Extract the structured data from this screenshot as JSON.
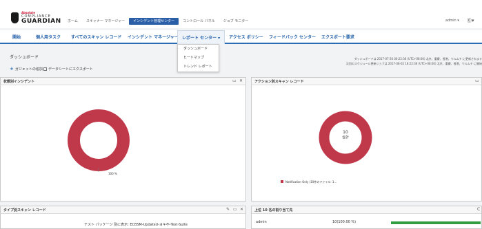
{
  "header": {
    "logo": {
      "brand": "Absolute",
      "line1": "COMPLIANCE",
      "line2": "GUARDIAN"
    },
    "top_nav": [
      "ホーム",
      "スキャナー マネージャー",
      "インシデント管理センター",
      "コントロール パネル",
      "ジョブ モニター"
    ],
    "top_nav_active_index": 2,
    "user": "admin ▾",
    "help": "⓪▾"
  },
  "main_nav": {
    "tabs": [
      "開始",
      "個人用タスク",
      "すべてのスキャン レコード",
      "インシデント マネージャー",
      "レポート センター ▾",
      "アクセス ポリシー",
      "フィードバック センター",
      "エクスポート要求"
    ],
    "active_index": 4
  },
  "dropdown": {
    "items": [
      "ダッシュボード",
      "ヒートマップ",
      "トレンド レポート"
    ]
  },
  "dashboard": {
    "title": "ダッシュボード",
    "add_gadget": "ガジェットの追加",
    "export_to_pdf": "データシートにエクスポート",
    "refresh_line1": "ダッシュボードは 2017-07-20 00:22:36 (UTC+08:00) 北京、重慶、香港、ウルムチ に更新されます",
    "refresh_line2": "次回のスケジュール更新ジョブは 2017-08-02 18:22:36 (UTC+08:00) 北京、重慶、香港、ウルムチ に開始"
  },
  "panels": {
    "status_incidents": {
      "title": "状態別インシデント",
      "ctl_min": "▭",
      "ctl_close": "✕",
      "slice_label": "100 %"
    },
    "action_scan_records": {
      "title": "アクション別スキャン レコード",
      "ctl_min": "▭",
      "center_value": "10",
      "center_label": "合計",
      "legend": "Notification Only (10件のファイル: 1..."
    },
    "type_scan_records": {
      "title": "タイプ別スキャン レコード",
      "ctl_edit": "✎",
      "ctl_min": "▭",
      "ctl_close": "✕",
      "info": "テスト パッケージ 別に表示: ECBSM-Updated-ヨキ不-Test-Suite"
    },
    "top_assignees": {
      "title": "上位 10 名の割り当て先",
      "ctl": "C",
      "rows": [
        {
          "name": "admin",
          "value": "10(100.00 %)",
          "fraction": 1.0
        }
      ]
    }
  },
  "colors": {
    "nav_blue": "#2a6cb3",
    "donut_red": "#c0394b",
    "bar_green": "#2e9e3e"
  }
}
